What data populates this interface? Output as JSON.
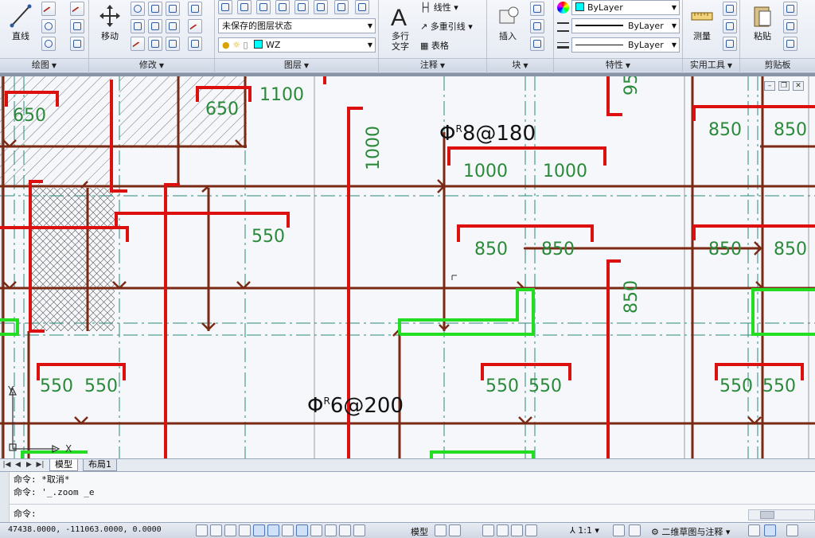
{
  "ribbon": {
    "draw": {
      "title": "绘图",
      "line_label": "直线"
    },
    "modify": {
      "title": "修改",
      "move_label": "移动"
    },
    "layers": {
      "title": "图层",
      "layer_state": "未保存的图层状态",
      "current_layer": "WZ"
    },
    "annotation": {
      "title": "注释",
      "mtext_label": "多行",
      "mtext_label2": "文字",
      "linear_label": "线性",
      "mleader_label": "多重引线",
      "table_label": "表格"
    },
    "block": {
      "title": "块",
      "insert_label": "插入"
    },
    "properties": {
      "title": "特性",
      "color": "ByLayer",
      "linetype": "ByLayer",
      "lineweight": "ByLayer"
    },
    "utilities": {
      "title": "实用工具",
      "measure_label": "测量"
    },
    "clipboard": {
      "title": "剪贴板",
      "paste_label": "粘贴"
    }
  },
  "drawing": {
    "dims": {
      "d650a": "650",
      "d650b": "650",
      "d1100": "1100",
      "d1000v": "1000",
      "d95": "95",
      "d850a": "850",
      "d850b": "850",
      "d1000a": "1000",
      "d1000b": "1000",
      "d550top": "550",
      "d850c": "850",
      "d850d": "850",
      "d850e": "850",
      "d850f": "850",
      "d850v": "850",
      "d550a": "550",
      "d550b": "550",
      "d550c": "550",
      "d550d": "550",
      "d550e": "550",
      "d550f": "550"
    },
    "rebar_labels": {
      "top": "8@180",
      "bottom": "6@200"
    },
    "rebar_symbol": "Φ",
    "rebar_sup": "R",
    "ucs_x": "X",
    "ucs_y": "Y"
  },
  "tabs": {
    "model": "模型",
    "layout1": "布局1"
  },
  "command": {
    "history": [
      "命令: *取消*",
      "命令: '_.zoom _e"
    ],
    "prompt": "命令:"
  },
  "status": {
    "coords": "47438.0000, -111063.0000, 0.0000",
    "model_label": "模型",
    "scale": "1:1",
    "workspace": "二维草图与注释"
  }
}
